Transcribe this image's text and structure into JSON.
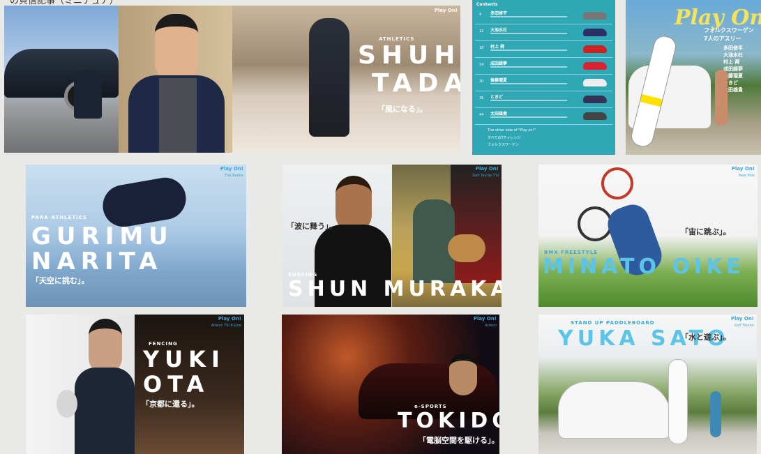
{
  "top_caption": "の貝信記事（ミニチュア）",
  "tiles": {
    "tada": {
      "name_line1": "SHUHEI",
      "name_line2": "TADA",
      "category": "ATHLETICS",
      "catch": "「風になる」。",
      "jp_name": "多田修平",
      "page_left": "Play On!"
    },
    "contents": {
      "header": "Contents",
      "items": [
        {
          "num": "4",
          "name": "多田修平"
        },
        {
          "num": "12",
          "name": "大池水杜"
        },
        {
          "num": "18",
          "name": "村上 舜"
        },
        {
          "num": "24",
          "name": "成田緑夢"
        },
        {
          "num": "30",
          "name": "後藤瑠夏"
        },
        {
          "num": "36",
          "name": "ときど"
        },
        {
          "num": "44",
          "name": "太田雄貴"
        }
      ],
      "footers": [
        "The other side of \"Play on!\"",
        "すべてのTチャレンジ",
        "フォルクスワーゲン"
      ]
    },
    "cover": {
      "logo": "Play On",
      "sub1": "フォルクスワーゲン",
      "sub2": "7人のアスリー",
      "names": [
        "多田修平",
        "大池水杜",
        "村上 舜",
        "成田緑夢",
        "後藤瑠夏",
        "ときど",
        "太田雄貴"
      ]
    },
    "narita": {
      "name_line1": "GURIMU",
      "name_line2": "NARITA",
      "category": "PARA-ATHLETICS",
      "catch": "「天空に挑む」。",
      "playon": "Play On!",
      "model": "The Beetle"
    },
    "murakami": {
      "name": "SHUN MURAKAMI",
      "category": "SURFING",
      "catch": "「波に舞う」。",
      "playon": "Play On!",
      "model": "Golf Touran TSI"
    },
    "oike": {
      "name": "MINATO OIKE",
      "category": "BMX FREESTYLE",
      "catch": "「宙に跳ぶ」。",
      "playon": "Play On!",
      "model": "New Polo"
    },
    "ota": {
      "name_line1": "YUKI",
      "name_line2": "OTA",
      "category": "FENCING",
      "catch": "「京都に還る」。",
      "playon": "Play On!",
      "model": "Arteon TSI R-Line"
    },
    "tokido": {
      "name": "TOKIDO",
      "category": "e-SPORTS",
      "catch": "「電脳空間を駆ける」。",
      "playon": "Play On!",
      "model": "Arteon"
    },
    "sato": {
      "name": "YUKA SATO",
      "category": "STAND UP PADDLEBOARD",
      "catch": "「水と遊ぶ」。",
      "playon": "Play On!",
      "model": "Golf Touran"
    }
  }
}
